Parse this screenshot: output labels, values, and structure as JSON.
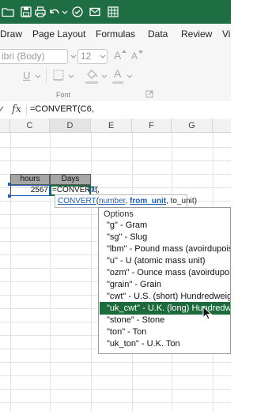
{
  "title_bar": {
    "icons": [
      "folder-icon",
      "save-icon",
      "print-icon",
      "undo-icon",
      "redo-icon",
      "check-icon",
      "mail-icon",
      "grid-icon"
    ]
  },
  "ribbon_tabs": [
    "Draw",
    "Page Layout",
    "Formulas",
    "Data",
    "Review",
    "Vi"
  ],
  "ribbon": {
    "font_name": "ibri (Body)",
    "font_size": "12",
    "grow_font": "A",
    "shrink_font": "A",
    "underline": "U",
    "font_color_letter": "A",
    "group_label": "Font"
  },
  "formula_bar": {
    "fx": "fx",
    "content": "=CONVERT(C6,"
  },
  "columns": [
    "C",
    "D",
    "E",
    "F",
    "G"
  ],
  "cells": {
    "c5": "hours",
    "d5": "Days",
    "c6": "2567",
    "d6": "=CONVERT(C6,"
  },
  "tooltip": {
    "fn": "CONVERT",
    "open": "(",
    "arg1": "number",
    "sep1": ", ",
    "arg2": "from_unit",
    "sep2": ", ",
    "arg3": "to_unit",
    "close": ")"
  },
  "dropdown": {
    "header": "Options",
    "options": [
      "\"g\" - Gram",
      "\"sg\" - Slug",
      "\"lbm\" - Pound mass (avoirdupois",
      "\"u\" - U (atomic mass unit)",
      "\"ozm\" - Ounce mass (avoirdupoi",
      "\"grain\" - Grain",
      "\"cwt\" - U.S. (short) Hundredweig",
      "\"uk_cwt\" - U.K. (long) Hundredw",
      "\"stone\" - Stone",
      "\"ton\" - Ton",
      "\"uk_ton\" - U.K. Ton"
    ],
    "selected_index": 7
  },
  "colors": {
    "title_bar": "#1f6e43",
    "selection": "#1d6b3c",
    "active_border": "#1f5fb4"
  }
}
